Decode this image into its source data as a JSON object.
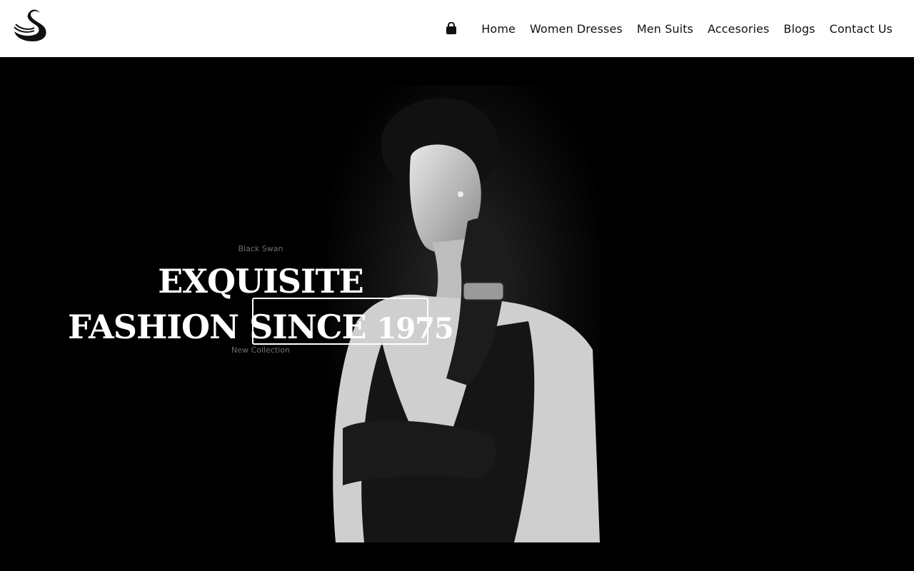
{
  "brand": {
    "logo_icon": "swan-icon"
  },
  "nav": {
    "cart_icon": "shopping-bag-icon",
    "items": [
      "Home",
      "Women Dresses",
      "Men Suits",
      "Accesories",
      "Blogs",
      "Contact Us"
    ]
  },
  "hero": {
    "eyebrow": "Black Swan",
    "line1": "EXQUISITE",
    "line2_a": "FASHION ",
    "line2_b": "SINCE ",
    "line2_c": "1975",
    "subtitle": "New Collection",
    "image_icon": "woman-portrait-image"
  }
}
